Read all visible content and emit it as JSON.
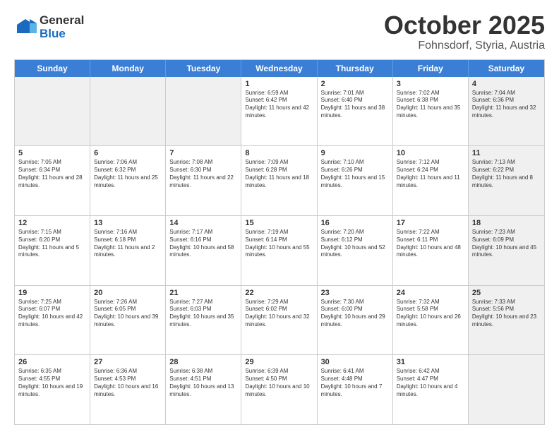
{
  "logo": {
    "general": "General",
    "blue": "Blue"
  },
  "title": "October 2025",
  "location": "Fohnsdorf, Styria, Austria",
  "header_days": [
    "Sunday",
    "Monday",
    "Tuesday",
    "Wednesday",
    "Thursday",
    "Friday",
    "Saturday"
  ],
  "weeks": [
    [
      {
        "day": "",
        "info": "",
        "shaded": true
      },
      {
        "day": "",
        "info": "",
        "shaded": true
      },
      {
        "day": "",
        "info": "",
        "shaded": true
      },
      {
        "day": "1",
        "info": "Sunrise: 6:59 AM\nSunset: 6:42 PM\nDaylight: 11 hours and 42 minutes."
      },
      {
        "day": "2",
        "info": "Sunrise: 7:01 AM\nSunset: 6:40 PM\nDaylight: 11 hours and 38 minutes."
      },
      {
        "day": "3",
        "info": "Sunrise: 7:02 AM\nSunset: 6:38 PM\nDaylight: 11 hours and 35 minutes."
      },
      {
        "day": "4",
        "info": "Sunrise: 7:04 AM\nSunset: 6:36 PM\nDaylight: 11 hours and 32 minutes.",
        "shaded": true
      }
    ],
    [
      {
        "day": "5",
        "info": "Sunrise: 7:05 AM\nSunset: 6:34 PM\nDaylight: 11 hours and 28 minutes."
      },
      {
        "day": "6",
        "info": "Sunrise: 7:06 AM\nSunset: 6:32 PM\nDaylight: 11 hours and 25 minutes."
      },
      {
        "day": "7",
        "info": "Sunrise: 7:08 AM\nSunset: 6:30 PM\nDaylight: 11 hours and 22 minutes."
      },
      {
        "day": "8",
        "info": "Sunrise: 7:09 AM\nSunset: 6:28 PM\nDaylight: 11 hours and 18 minutes."
      },
      {
        "day": "9",
        "info": "Sunrise: 7:10 AM\nSunset: 6:26 PM\nDaylight: 11 hours and 15 minutes."
      },
      {
        "day": "10",
        "info": "Sunrise: 7:12 AM\nSunset: 6:24 PM\nDaylight: 11 hours and 11 minutes."
      },
      {
        "day": "11",
        "info": "Sunrise: 7:13 AM\nSunset: 6:22 PM\nDaylight: 11 hours and 8 minutes.",
        "shaded": true
      }
    ],
    [
      {
        "day": "12",
        "info": "Sunrise: 7:15 AM\nSunset: 6:20 PM\nDaylight: 11 hours and 5 minutes."
      },
      {
        "day": "13",
        "info": "Sunrise: 7:16 AM\nSunset: 6:18 PM\nDaylight: 11 hours and 2 minutes."
      },
      {
        "day": "14",
        "info": "Sunrise: 7:17 AM\nSunset: 6:16 PM\nDaylight: 10 hours and 58 minutes."
      },
      {
        "day": "15",
        "info": "Sunrise: 7:19 AM\nSunset: 6:14 PM\nDaylight: 10 hours and 55 minutes."
      },
      {
        "day": "16",
        "info": "Sunrise: 7:20 AM\nSunset: 6:12 PM\nDaylight: 10 hours and 52 minutes."
      },
      {
        "day": "17",
        "info": "Sunrise: 7:22 AM\nSunset: 6:11 PM\nDaylight: 10 hours and 48 minutes."
      },
      {
        "day": "18",
        "info": "Sunrise: 7:23 AM\nSunset: 6:09 PM\nDaylight: 10 hours and 45 minutes.",
        "shaded": true
      }
    ],
    [
      {
        "day": "19",
        "info": "Sunrise: 7:25 AM\nSunset: 6:07 PM\nDaylight: 10 hours and 42 minutes."
      },
      {
        "day": "20",
        "info": "Sunrise: 7:26 AM\nSunset: 6:05 PM\nDaylight: 10 hours and 39 minutes."
      },
      {
        "day": "21",
        "info": "Sunrise: 7:27 AM\nSunset: 6:03 PM\nDaylight: 10 hours and 35 minutes."
      },
      {
        "day": "22",
        "info": "Sunrise: 7:29 AM\nSunset: 6:02 PM\nDaylight: 10 hours and 32 minutes."
      },
      {
        "day": "23",
        "info": "Sunrise: 7:30 AM\nSunset: 6:00 PM\nDaylight: 10 hours and 29 minutes."
      },
      {
        "day": "24",
        "info": "Sunrise: 7:32 AM\nSunset: 5:58 PM\nDaylight: 10 hours and 26 minutes."
      },
      {
        "day": "25",
        "info": "Sunrise: 7:33 AM\nSunset: 5:56 PM\nDaylight: 10 hours and 23 minutes.",
        "shaded": true
      }
    ],
    [
      {
        "day": "26",
        "info": "Sunrise: 6:35 AM\nSunset: 4:55 PM\nDaylight: 10 hours and 19 minutes."
      },
      {
        "day": "27",
        "info": "Sunrise: 6:36 AM\nSunset: 4:53 PM\nDaylight: 10 hours and 16 minutes."
      },
      {
        "day": "28",
        "info": "Sunrise: 6:38 AM\nSunset: 4:51 PM\nDaylight: 10 hours and 13 minutes."
      },
      {
        "day": "29",
        "info": "Sunrise: 6:39 AM\nSunset: 4:50 PM\nDaylight: 10 hours and 10 minutes."
      },
      {
        "day": "30",
        "info": "Sunrise: 6:41 AM\nSunset: 4:48 PM\nDaylight: 10 hours and 7 minutes."
      },
      {
        "day": "31",
        "info": "Sunrise: 6:42 AM\nSunset: 4:47 PM\nDaylight: 10 hours and 4 minutes."
      },
      {
        "day": "",
        "info": "",
        "shaded": true
      }
    ]
  ]
}
